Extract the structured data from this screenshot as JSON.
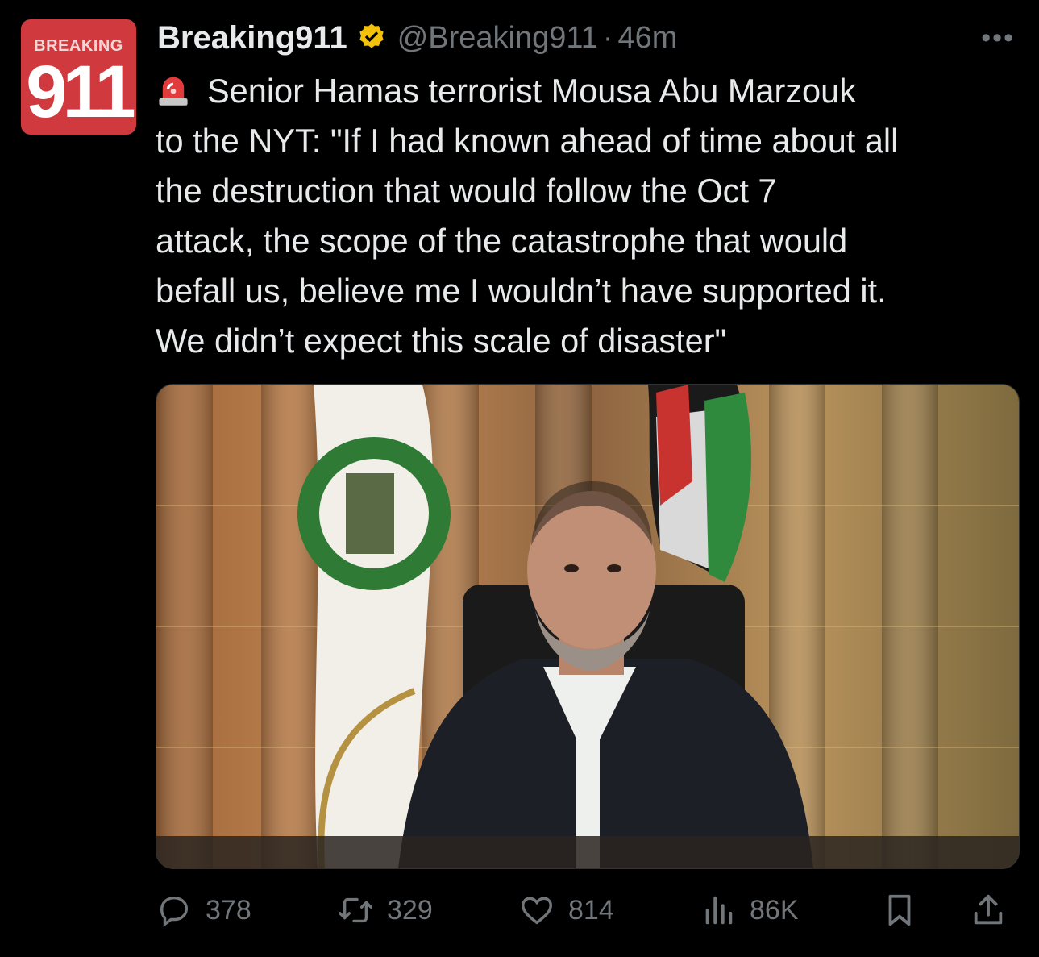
{
  "avatar": {
    "top_word": "BREAKING",
    "number": "911",
    "brand_color": "#d03a3e"
  },
  "header": {
    "display_name": "Breaking911",
    "verified_icon": "verified-badge-icon",
    "handle": "@Breaking911",
    "separator": "·",
    "time": "46m",
    "more_icon": "more-options-icon"
  },
  "tweet": {
    "emoji_icon": "siren-icon",
    "text": "Senior Hamas terrorist Mousa Abu Marzouk\nto the NYT: \"If I had known ahead of time about all\nthe destruction that would follow the Oct 7\nattack, the scope of the catastrophe that would\nbefall us, believe me I wouldn’t have supported it.\nWe didn’t expect this scale of disaster\""
  },
  "media": {
    "icon": "photo-man-at-desk"
  },
  "actions": {
    "reply": {
      "icon": "reply-icon",
      "count": "378"
    },
    "retweet": {
      "icon": "retweet-icon",
      "count": "329"
    },
    "like": {
      "icon": "heart-icon",
      "count": "814"
    },
    "views": {
      "icon": "views-icon",
      "count": "86K"
    },
    "bookmark": {
      "icon": "bookmark-icon"
    },
    "share": {
      "icon": "share-icon"
    }
  },
  "colors": {
    "background": "#000000",
    "text": "#e7e9ea",
    "muted": "#71767b",
    "verified": "#f4c20d"
  }
}
